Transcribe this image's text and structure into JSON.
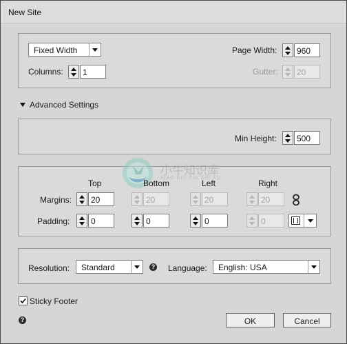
{
  "window": {
    "title": "New Site"
  },
  "layout": {
    "type_value": "Fixed Width",
    "page_width_label": "Page Width:",
    "page_width_value": "960",
    "columns_label": "Columns:",
    "columns_value": "1",
    "gutter_label": "Gutter:",
    "gutter_value": "20"
  },
  "advanced": {
    "label": "Advanced Settings",
    "expanded": true,
    "min_height_label": "Min Height:",
    "min_height_value": "500"
  },
  "spacing": {
    "columns": [
      "Top",
      "Bottom",
      "Left",
      "Right"
    ],
    "margins_label": "Margins:",
    "margins": {
      "top": "20",
      "bottom": "20",
      "left": "20",
      "right": "20"
    },
    "padding_label": "Padding:",
    "padding": {
      "top": "0",
      "bottom": "0",
      "left": "0",
      "right": "0"
    }
  },
  "watermark": {
    "text": "小牛知识库",
    "subtext": "XIAO NIU ZHI SHI KU"
  },
  "settings": {
    "resolution_label": "Resolution:",
    "resolution_value": "Standard",
    "language_label": "Language:",
    "language_value": "English: USA"
  },
  "footer": {
    "sticky_label": "Sticky Footer",
    "sticky_checked": true,
    "ok_label": "OK",
    "cancel_label": "Cancel"
  },
  "colors": {
    "dialog_bg": "#d6d6d6",
    "panel_border": "#9a9a9a",
    "disabled_text": "#a6a6a6"
  }
}
